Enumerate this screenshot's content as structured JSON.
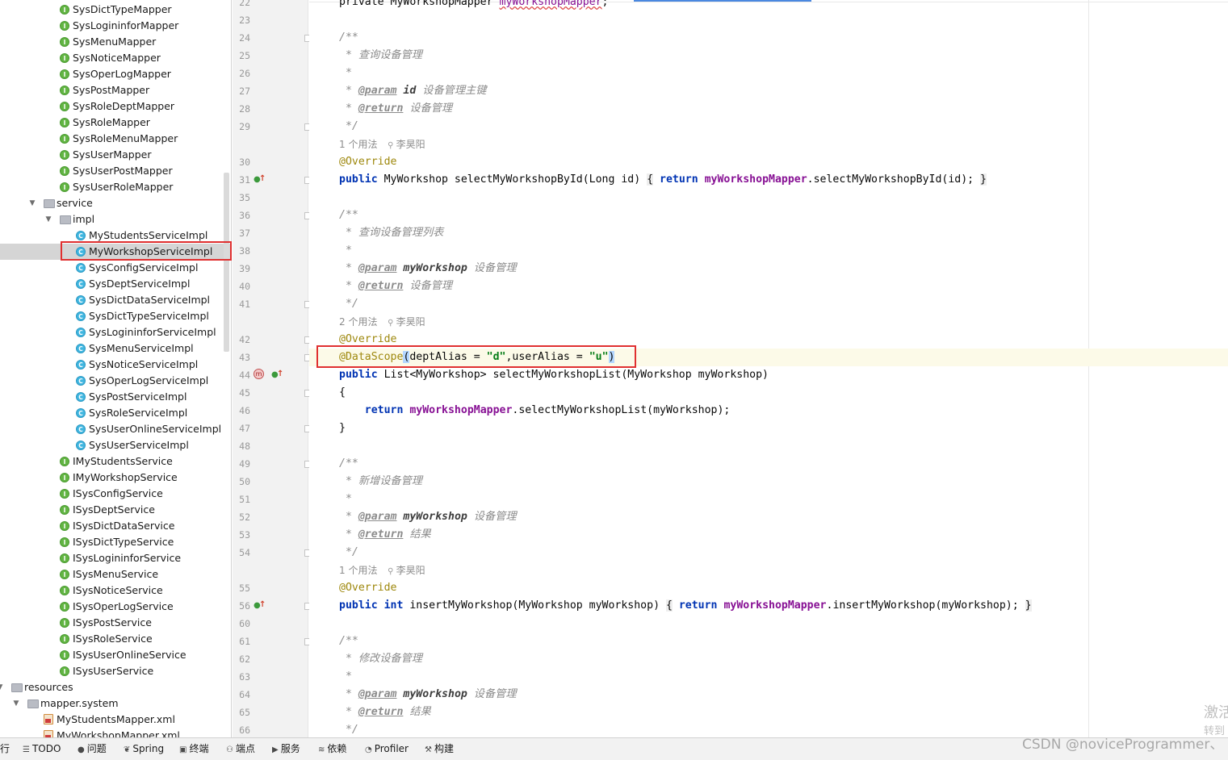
{
  "tree": [
    {
      "label": "SysDictTypeMapper",
      "icon": "interface-icon",
      "indent": 74
    },
    {
      "label": "SysLogininforMapper",
      "icon": "interface-icon",
      "indent": 74
    },
    {
      "label": "SysMenuMapper",
      "icon": "interface-icon",
      "indent": 74
    },
    {
      "label": "SysNoticeMapper",
      "icon": "interface-icon",
      "indent": 74
    },
    {
      "label": "SysOperLogMapper",
      "icon": "interface-icon",
      "indent": 74
    },
    {
      "label": "SysPostMapper",
      "icon": "interface-icon",
      "indent": 74
    },
    {
      "label": "SysRoleDeptMapper",
      "icon": "interface-icon",
      "indent": 74
    },
    {
      "label": "SysRoleMapper",
      "icon": "interface-icon",
      "indent": 74
    },
    {
      "label": "SysRoleMenuMapper",
      "icon": "interface-icon",
      "indent": 74
    },
    {
      "label": "SysUserMapper",
      "icon": "interface-icon",
      "indent": 74
    },
    {
      "label": "SysUserPostMapper",
      "icon": "interface-icon",
      "indent": 74
    },
    {
      "label": "SysUserRoleMapper",
      "icon": "interface-icon",
      "indent": 74
    },
    {
      "label": "service",
      "icon": "folder-icon",
      "indent": 54,
      "expanded": true
    },
    {
      "label": "impl",
      "icon": "folder-icon",
      "indent": 74,
      "expanded": true
    },
    {
      "label": "MyStudentsServiceImpl",
      "icon": "class-icon",
      "indent": 94
    },
    {
      "label": "MyWorkshopServiceImpl",
      "icon": "class-icon",
      "indent": 94,
      "selected": true
    },
    {
      "label": "SysConfigServiceImpl",
      "icon": "class-icon",
      "indent": 94
    },
    {
      "label": "SysDeptServiceImpl",
      "icon": "class-icon",
      "indent": 94
    },
    {
      "label": "SysDictDataServiceImpl",
      "icon": "class-icon",
      "indent": 94
    },
    {
      "label": "SysDictTypeServiceImpl",
      "icon": "class-icon",
      "indent": 94
    },
    {
      "label": "SysLogininforServiceImpl",
      "icon": "class-icon",
      "indent": 94
    },
    {
      "label": "SysMenuServiceImpl",
      "icon": "class-icon",
      "indent": 94
    },
    {
      "label": "SysNoticeServiceImpl",
      "icon": "class-icon",
      "indent": 94
    },
    {
      "label": "SysOperLogServiceImpl",
      "icon": "class-icon",
      "indent": 94
    },
    {
      "label": "SysPostServiceImpl",
      "icon": "class-icon",
      "indent": 94
    },
    {
      "label": "SysRoleServiceImpl",
      "icon": "class-icon",
      "indent": 94
    },
    {
      "label": "SysUserOnlineServiceImpl",
      "icon": "class-icon",
      "indent": 94
    },
    {
      "label": "SysUserServiceImpl",
      "icon": "class-icon",
      "indent": 94
    },
    {
      "label": "IMyStudentsService",
      "icon": "interface-icon",
      "indent": 74
    },
    {
      "label": "IMyWorkshopService",
      "icon": "interface-icon",
      "indent": 74
    },
    {
      "label": "ISysConfigService",
      "icon": "interface-icon",
      "indent": 74
    },
    {
      "label": "ISysDeptService",
      "icon": "interface-icon",
      "indent": 74
    },
    {
      "label": "ISysDictDataService",
      "icon": "interface-icon",
      "indent": 74
    },
    {
      "label": "ISysDictTypeService",
      "icon": "interface-icon",
      "indent": 74
    },
    {
      "label": "ISysLogininforService",
      "icon": "interface-icon",
      "indent": 74
    },
    {
      "label": "ISysMenuService",
      "icon": "interface-icon",
      "indent": 74
    },
    {
      "label": "ISysNoticeService",
      "icon": "interface-icon",
      "indent": 74
    },
    {
      "label": "ISysOperLogService",
      "icon": "interface-icon",
      "indent": 74
    },
    {
      "label": "ISysPostService",
      "icon": "interface-icon",
      "indent": 74
    },
    {
      "label": "ISysRoleService",
      "icon": "interface-icon",
      "indent": 74
    },
    {
      "label": "ISysUserOnlineService",
      "icon": "interface-icon",
      "indent": 74
    },
    {
      "label": "ISysUserService",
      "icon": "interface-icon",
      "indent": 74
    },
    {
      "label": "resources",
      "icon": "resources-folder-icon",
      "indent": 14,
      "expanded": true
    },
    {
      "label": "mapper.system",
      "icon": "folder-icon",
      "indent": 34,
      "expanded": true
    },
    {
      "label": "MyStudentsMapper.xml",
      "icon": "xml-icon",
      "indent": 54
    },
    {
      "label": "MyWorkshopMapper.xml",
      "icon": "xml-icon",
      "indent": 54
    }
  ],
  "code": [
    {
      "n": "22",
      "type": "code",
      "tokens": [
        [
          "kw0",
          "private MyWorkshopMapper "
        ],
        [
          "wavy",
          "myWorkshopMapper"
        ],
        [
          "",
          ";"
        ]
      ]
    },
    {
      "n": "23",
      "type": "code",
      "tokens": []
    },
    {
      "n": "24",
      "type": "code",
      "tokens": [
        [
          "cmt",
          "/**"
        ]
      ],
      "fold": true
    },
    {
      "n": "25",
      "type": "code",
      "tokens": [
        [
          "cmt",
          " * 查询设备管理"
        ]
      ]
    },
    {
      "n": "26",
      "type": "code",
      "tokens": [
        [
          "cmt",
          " *"
        ]
      ]
    },
    {
      "n": "27",
      "type": "code",
      "tokens": [
        [
          "cmt",
          " * "
        ],
        [
          "tag",
          "@param"
        ],
        [
          "cmt",
          " "
        ],
        [
          "pnm",
          "id"
        ],
        [
          "cmt",
          " 设备管理主键"
        ]
      ]
    },
    {
      "n": "28",
      "type": "code",
      "tokens": [
        [
          "cmt",
          " * "
        ],
        [
          "tag",
          "@return"
        ],
        [
          "cmt",
          " 设备管理"
        ]
      ]
    },
    {
      "n": "29",
      "type": "code",
      "tokens": [
        [
          "cmt",
          " */"
        ]
      ],
      "fold": true
    },
    {
      "type": "hint",
      "text": "1 个用法",
      "author": "李昊阳"
    },
    {
      "n": "30",
      "type": "code",
      "tokens": [
        [
          "ann",
          "@Override"
        ]
      ]
    },
    {
      "n": "31",
      "type": "code",
      "tokens": [
        [
          "kw",
          "public"
        ],
        [
          "",
          " MyWorkshop selectMyWorkshopById(Long id) "
        ],
        [
          "brk",
          "{"
        ],
        [
          "",
          " "
        ],
        [
          "kw",
          "return"
        ],
        [
          "",
          " "
        ],
        [
          "fld",
          "myWorkshopMapper"
        ],
        [
          "",
          ".selectMyWorkshopById(id); "
        ],
        [
          "brk",
          "}"
        ]
      ],
      "fold": true,
      "marks": [
        "override"
      ]
    },
    {
      "n": "35",
      "type": "code",
      "tokens": []
    },
    {
      "n": "36",
      "type": "code",
      "tokens": [
        [
          "cmt",
          "/**"
        ]
      ],
      "fold": true
    },
    {
      "n": "37",
      "type": "code",
      "tokens": [
        [
          "cmt",
          " * 查询设备管理列表"
        ]
      ]
    },
    {
      "n": "38",
      "type": "code",
      "tokens": [
        [
          "cmt",
          " *"
        ]
      ]
    },
    {
      "n": "39",
      "type": "code",
      "tokens": [
        [
          "cmt",
          " * "
        ],
        [
          "tag",
          "@param"
        ],
        [
          "cmt",
          " "
        ],
        [
          "pnm",
          "myWorkshop"
        ],
        [
          "cmt",
          " 设备管理"
        ]
      ]
    },
    {
      "n": "40",
      "type": "code",
      "tokens": [
        [
          "cmt",
          " * "
        ],
        [
          "tag",
          "@return"
        ],
        [
          "cmt",
          " 设备管理"
        ]
      ]
    },
    {
      "n": "41",
      "type": "code",
      "tokens": [
        [
          "cmt",
          " */"
        ]
      ],
      "fold": true
    },
    {
      "type": "hint",
      "text": "2 个用法",
      "author": "李昊阳"
    },
    {
      "n": "42",
      "type": "code",
      "tokens": [
        [
          "ann",
          "@Override"
        ]
      ],
      "fold": true
    },
    {
      "n": "43",
      "type": "code",
      "current": true,
      "tokens": [
        [
          "ann",
          "@DataScope"
        ],
        [
          "brk2",
          "("
        ],
        [
          "",
          "deptAlias = "
        ],
        [
          "str",
          "\"d\""
        ],
        [
          "",
          ",userAlias = "
        ],
        [
          "str",
          "\"u\""
        ],
        [
          "brk2",
          ")"
        ]
      ],
      "fold": true
    },
    {
      "n": "44",
      "type": "code",
      "tokens": [
        [
          "kw",
          "public"
        ],
        [
          "",
          " List<MyWorkshop> selectMyWorkshopList(MyWorkshop myWorkshop)"
        ]
      ],
      "marks": [
        "m",
        "override"
      ]
    },
    {
      "n": "45",
      "type": "code",
      "tokens": [
        [
          "",
          "{"
        ]
      ],
      "fold": true
    },
    {
      "n": "46",
      "type": "code",
      "tokens": [
        [
          "",
          "    "
        ],
        [
          "kw",
          "return"
        ],
        [
          "",
          " "
        ],
        [
          "fld",
          "myWorkshopMapper"
        ],
        [
          "",
          ".selectMyWorkshopList(myWorkshop);"
        ]
      ]
    },
    {
      "n": "47",
      "type": "code",
      "tokens": [
        [
          "",
          "}"
        ]
      ],
      "fold": true
    },
    {
      "n": "48",
      "type": "code",
      "tokens": []
    },
    {
      "n": "49",
      "type": "code",
      "tokens": [
        [
          "cmt",
          "/**"
        ]
      ],
      "fold": true
    },
    {
      "n": "50",
      "type": "code",
      "tokens": [
        [
          "cmt",
          " * 新增设备管理"
        ]
      ]
    },
    {
      "n": "51",
      "type": "code",
      "tokens": [
        [
          "cmt",
          " *"
        ]
      ]
    },
    {
      "n": "52",
      "type": "code",
      "tokens": [
        [
          "cmt",
          " * "
        ],
        [
          "tag",
          "@param"
        ],
        [
          "cmt",
          " "
        ],
        [
          "pnm",
          "myWorkshop"
        ],
        [
          "cmt",
          " 设备管理"
        ]
      ]
    },
    {
      "n": "53",
      "type": "code",
      "tokens": [
        [
          "cmt",
          " * "
        ],
        [
          "tag",
          "@return"
        ],
        [
          "cmt",
          " 结果"
        ]
      ]
    },
    {
      "n": "54",
      "type": "code",
      "tokens": [
        [
          "cmt",
          " */"
        ]
      ],
      "fold": true
    },
    {
      "type": "hint",
      "text": "1 个用法",
      "author": "李昊阳"
    },
    {
      "n": "55",
      "type": "code",
      "tokens": [
        [
          "ann",
          "@Override"
        ]
      ]
    },
    {
      "n": "56",
      "type": "code",
      "tokens": [
        [
          "kw",
          "public"
        ],
        [
          "",
          " "
        ],
        [
          "kw",
          "int"
        ],
        [
          "",
          " insertMyWorkshop(MyWorkshop myWorkshop) "
        ],
        [
          "brk",
          "{"
        ],
        [
          "",
          " "
        ],
        [
          "kw",
          "return"
        ],
        [
          "",
          " "
        ],
        [
          "fld",
          "myWorkshopMapper"
        ],
        [
          "",
          ".insertMyWorkshop(myWorkshop); "
        ],
        [
          "brk",
          "}"
        ]
      ],
      "fold": true,
      "marks": [
        "override"
      ]
    },
    {
      "n": "60",
      "type": "code",
      "tokens": []
    },
    {
      "n": "61",
      "type": "code",
      "tokens": [
        [
          "cmt",
          "/**"
        ]
      ],
      "fold": true
    },
    {
      "n": "62",
      "type": "code",
      "tokens": [
        [
          "cmt",
          " * 修改设备管理"
        ]
      ]
    },
    {
      "n": "63",
      "type": "code",
      "tokens": [
        [
          "cmt",
          " *"
        ]
      ]
    },
    {
      "n": "64",
      "type": "code",
      "tokens": [
        [
          "cmt",
          " * "
        ],
        [
          "tag",
          "@param"
        ],
        [
          "cmt",
          " "
        ],
        [
          "pnm",
          "myWorkshop"
        ],
        [
          "cmt",
          " 设备管理"
        ]
      ]
    },
    {
      "n": "65",
      "type": "code",
      "tokens": [
        [
          "cmt",
          " * "
        ],
        [
          "tag",
          "@return"
        ],
        [
          "cmt",
          " 结果"
        ]
      ]
    },
    {
      "n": "66",
      "type": "code",
      "tokens": [
        [
          "cmt",
          " */"
        ]
      ]
    }
  ],
  "statusbar": [
    {
      "label": "行",
      "icon": "run-icon"
    },
    {
      "label": "TODO",
      "icon": "list-icon"
    },
    {
      "label": "问题",
      "icon": "info-icon"
    },
    {
      "label": "Spring",
      "icon": "spring-icon"
    },
    {
      "label": "终端",
      "icon": "terminal-icon"
    },
    {
      "label": "端点",
      "icon": "endpoints-icon"
    },
    {
      "label": "服务",
      "icon": "services-icon"
    },
    {
      "label": "依赖",
      "icon": "layers-icon"
    },
    {
      "label": "Profiler",
      "icon": "profiler-icon"
    },
    {
      "label": "构建",
      "icon": "hammer-icon"
    }
  ],
  "watermark": "CSDN @noviceProgrammer、",
  "activate_line1": "激活",
  "activate_line2": "转到"
}
